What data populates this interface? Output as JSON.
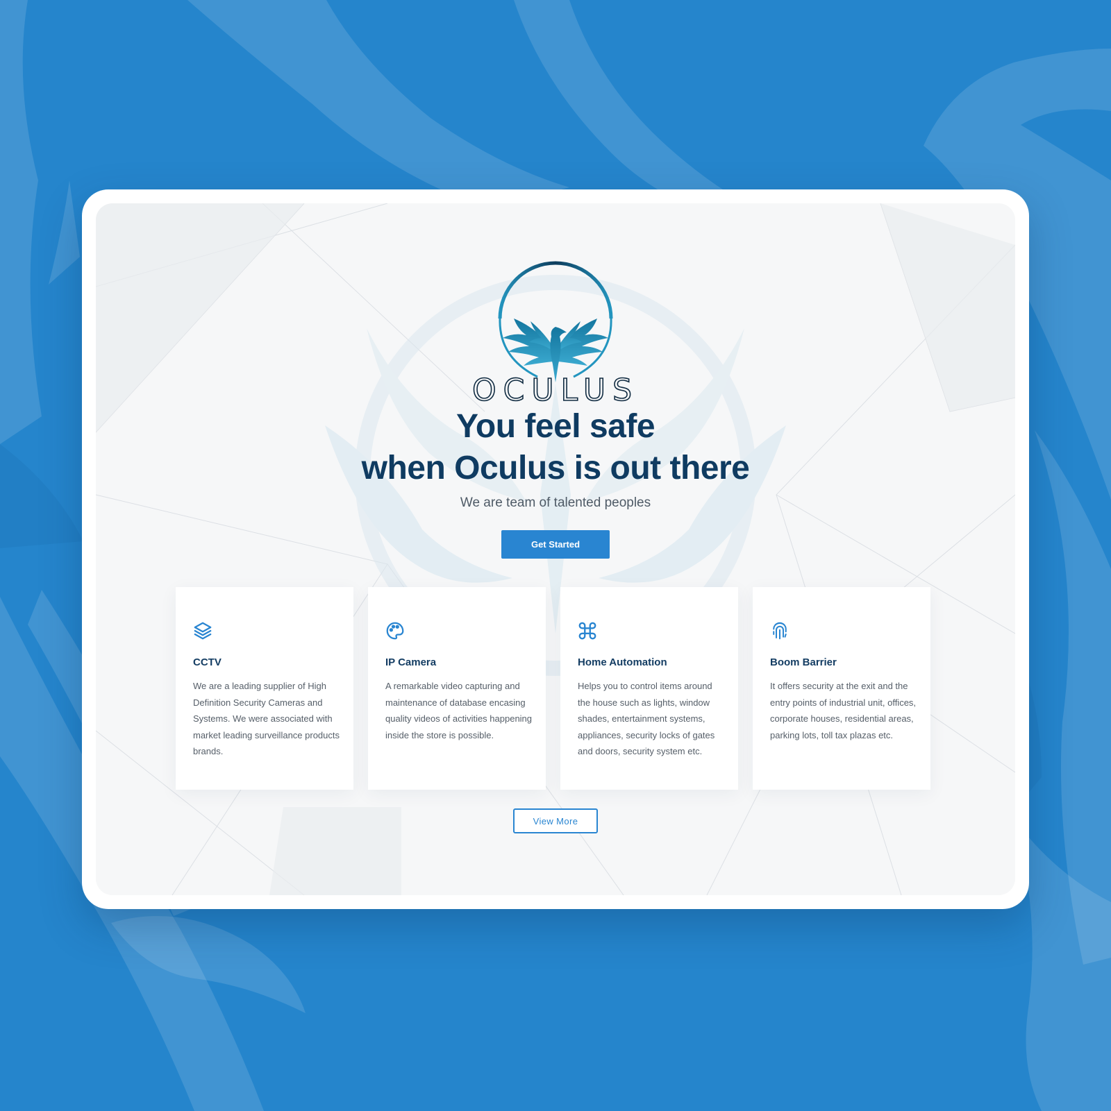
{
  "brand": {
    "name": "OCULUS"
  },
  "hero": {
    "headline_line1": "You feel safe",
    "headline_line2": "when Oculus is out there",
    "subtitle": "We are team of talented peoples",
    "cta_label": "Get Started"
  },
  "services": [
    {
      "icon": "layers-icon",
      "title": "CCTV",
      "description": "We are a leading supplier of High Definition Security Cameras and Systems. We were associated with market leading surveillance products brands."
    },
    {
      "icon": "palette-icon",
      "title": "IP Camera",
      "description": "A remarkable video capturing and maintenance of database encasing quality videos of activities happening inside the store is possible."
    },
    {
      "icon": "command-icon",
      "title": "Home Automation",
      "description": "Helps you to control items around the house such as lights, window shades, entertainment systems, appliances, security locks of gates and doors, security system etc."
    },
    {
      "icon": "fingerprint-icon",
      "title": "Boom Barrier",
      "description": "It offers security at the exit and the entry points of industrial unit, offices, corporate houses, residential areas, parking lots, toll tax plazas etc."
    }
  ],
  "view_more_label": "View More",
  "colors": {
    "background_blue": "#2585cc",
    "primary_blue": "#2985d1",
    "heading_navy": "#0f3b61",
    "logo_teal": "#1f8fb8"
  }
}
